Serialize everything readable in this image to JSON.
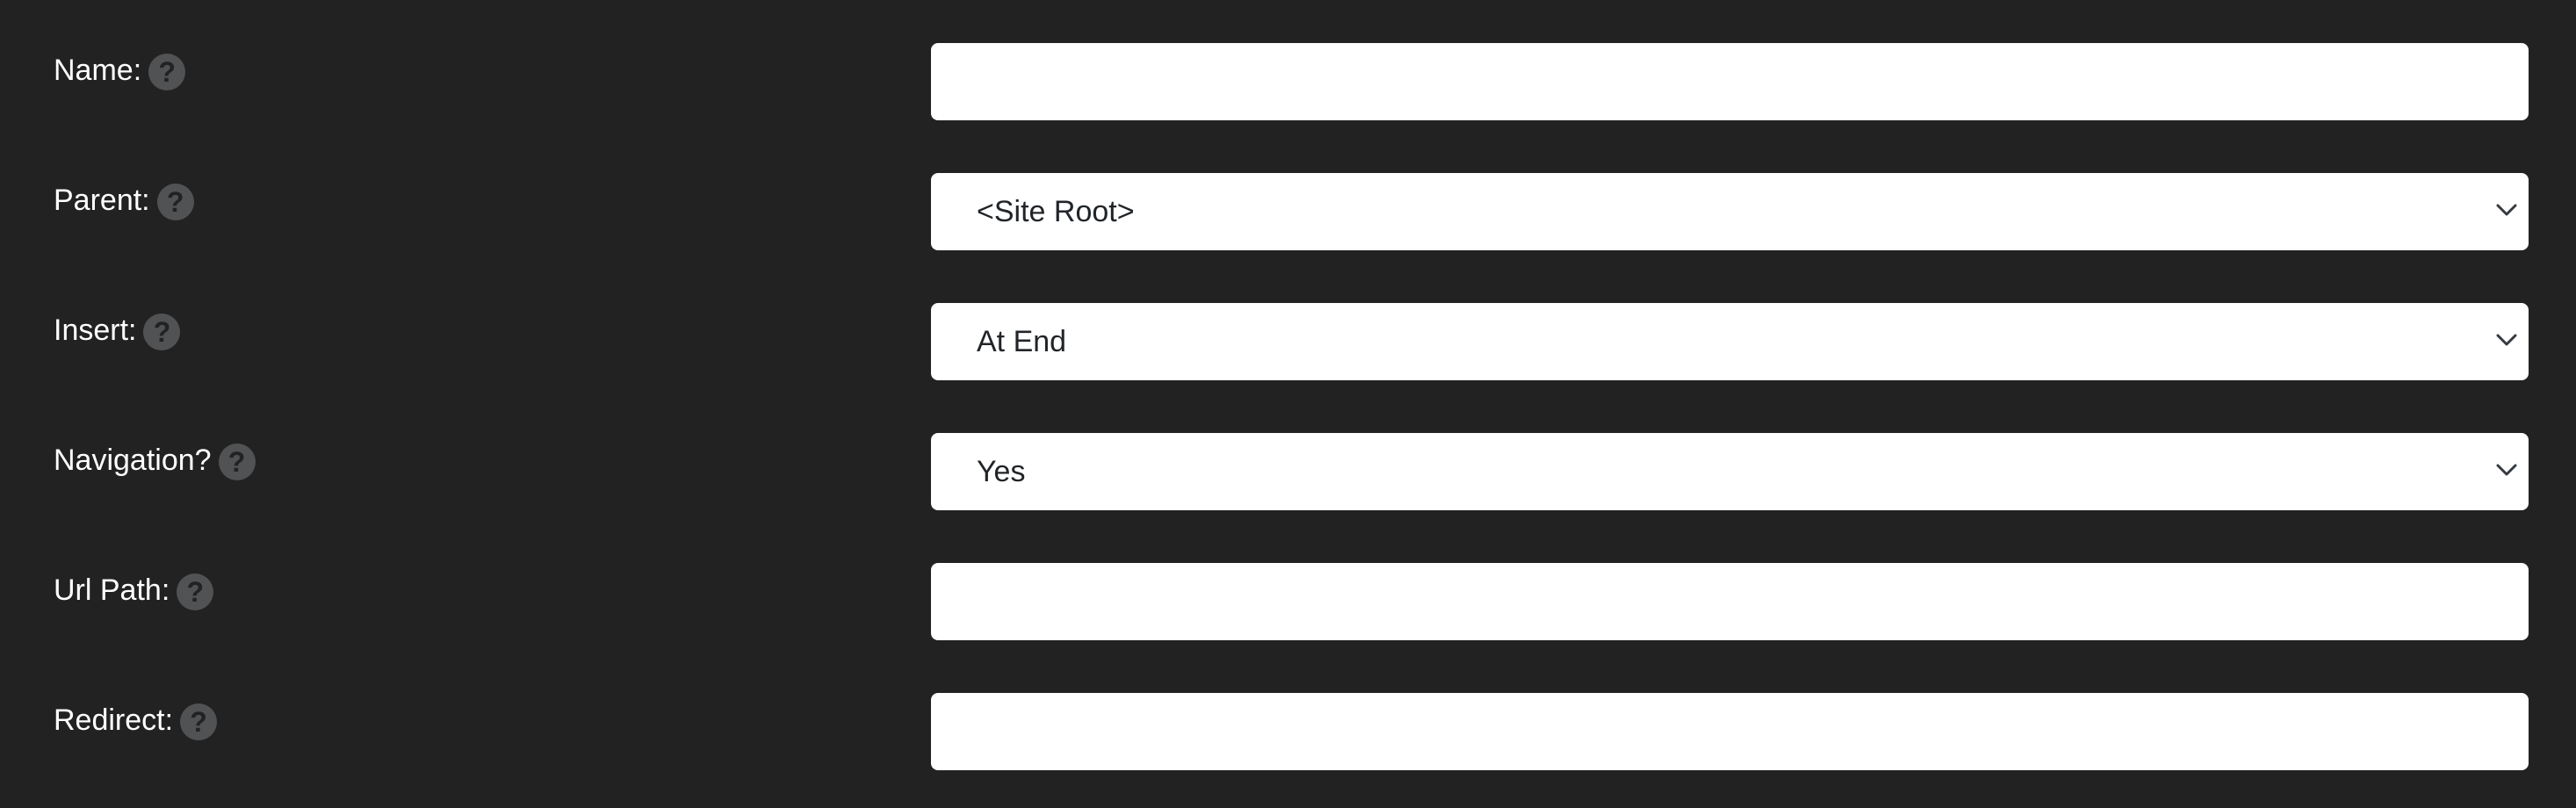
{
  "form": {
    "fields": [
      {
        "label": "Name:",
        "type": "text",
        "value": ""
      },
      {
        "label": "Parent:",
        "type": "select",
        "selected": "<Site Root>"
      },
      {
        "label": "Insert:",
        "type": "select",
        "selected": "At End"
      },
      {
        "label": "Navigation?",
        "type": "select",
        "selected": "Yes"
      },
      {
        "label": "Url Path:",
        "type": "text",
        "value": ""
      },
      {
        "label": "Redirect:",
        "type": "text",
        "value": ""
      }
    ],
    "help_icon_glyph": "?",
    "colors": {
      "background": "#222222",
      "label": "#ffffff",
      "field_background": "#ffffff",
      "help_icon": "#505254",
      "field_text": "#212529"
    },
    "icons": {
      "help": "question-circle-icon",
      "select_arrow": "chevron-down-icon"
    }
  }
}
